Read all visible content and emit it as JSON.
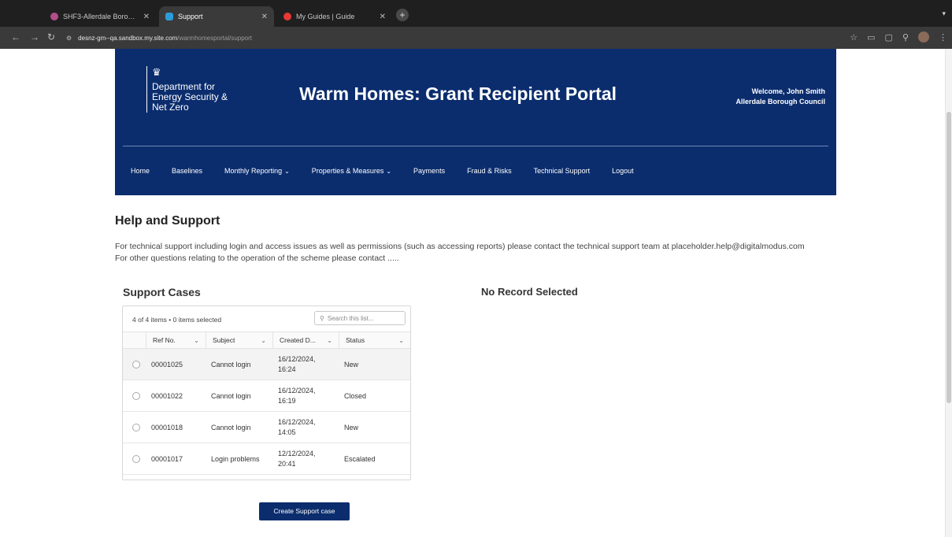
{
  "browser": {
    "tabs": [
      {
        "title": "SHF3-Allerdale Borough Cou...",
        "favicon_color": "#b04f8a",
        "active": false
      },
      {
        "title": "Support",
        "favicon_color": "#2d9cdb",
        "active": true
      },
      {
        "title": "My Guides | Guide",
        "favicon_color": "#e53935",
        "active": false
      }
    ],
    "new_tab": "+",
    "url_host": "desnz-gm--qa.sandbox.my.site.com",
    "url_path": "/warmhomesportal/support"
  },
  "header": {
    "dept_name": "Department for Energy Security & Net Zero",
    "portal_title": "Warm Homes: Grant Recipient Portal",
    "welcome": "Welcome, John Smith",
    "council": "Allerdale Borough Council"
  },
  "nav": {
    "items": [
      {
        "label": "Home",
        "dropdown": false
      },
      {
        "label": "Baselines",
        "dropdown": false
      },
      {
        "label": "Monthly Reporting",
        "dropdown": true
      },
      {
        "label": "Properties & Measures",
        "dropdown": true
      },
      {
        "label": "Payments",
        "dropdown": false
      },
      {
        "label": "Fraud & Risks",
        "dropdown": false
      },
      {
        "label": "Technical Support",
        "dropdown": false
      },
      {
        "label": "Logout",
        "dropdown": false
      }
    ]
  },
  "help": {
    "title": "Help and Support",
    "text": "For technical support including login and access issues as well as permissions (such as accessing reports) please contact the technical support team at placeholder.help@digitalmodus.com For other questions relating to the operation of the scheme please contact ....."
  },
  "cases": {
    "title": "Support Cases",
    "info": "4 of 4 items • 0 items selected",
    "search_placeholder": "Search this list...",
    "columns": [
      "Ref No.",
      "Subject",
      "Created D...",
      "Status"
    ],
    "rows": [
      {
        "ref": "00001025",
        "subject": "Cannot login",
        "created": "16/12/2024, 16:24",
        "status": "New"
      },
      {
        "ref": "00001022",
        "subject": "Cannot login",
        "created": "16/12/2024, 16:19",
        "status": "Closed"
      },
      {
        "ref": "00001018",
        "subject": "Cannot login",
        "created": "16/12/2024, 14:05",
        "status": "New"
      },
      {
        "ref": "00001017",
        "subject": "Login problems",
        "created": "12/12/2024, 20:41",
        "status": "Escalated"
      }
    ],
    "create_button": "Create Support case"
  },
  "detail": {
    "empty_text": "No Record Selected"
  },
  "colors": {
    "brand_navy": "#0b2d6e",
    "browser_dark": "#1f1f1f"
  }
}
